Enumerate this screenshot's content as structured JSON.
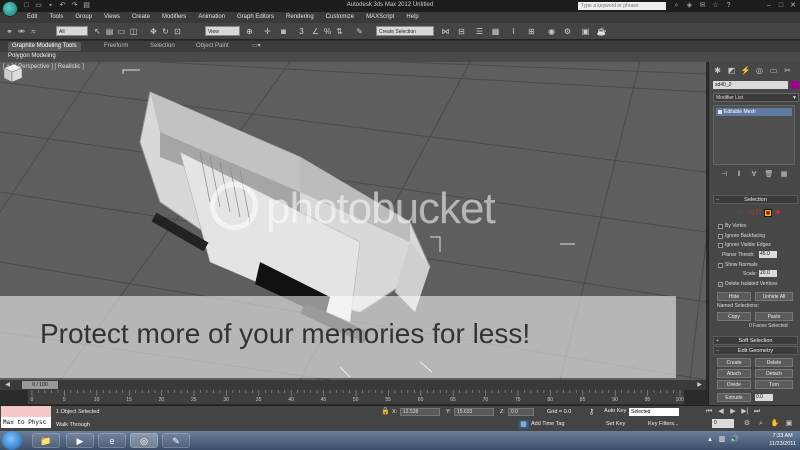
{
  "titlebar": {
    "title": "Autodesk 3ds Max 2012     Untitled",
    "help_search_placeholder": "Type a keyword or phrase",
    "quick_access": [
      "new-icon",
      "open-icon",
      "save-icon",
      "undo-icon",
      "redo-icon",
      "project-folder-icon"
    ],
    "icons": [
      "search-icon",
      "subscription-icon",
      "comm-center-icon",
      "favorites-icon",
      "help-icon"
    ]
  },
  "menu": {
    "items": [
      "Edit",
      "Tools",
      "Group",
      "Views",
      "Create",
      "Modifiers",
      "Animation",
      "Graph Editors",
      "Rendering",
      "Customize",
      "MAXScript",
      "Help"
    ]
  },
  "toolbar": {
    "selection_filter": "All",
    "reference_coord": "View",
    "named_selection": "Create Selection"
  },
  "ribbon": {
    "tabs": [
      "Graphite Modeling Tools",
      "Freeform",
      "Selection",
      "Object Paint"
    ],
    "panel_label": "Polygon Modeling"
  },
  "viewport": {
    "label": "[ + ] [ Perspective ] [ Realistic ]"
  },
  "command_panel": {
    "object_name": "sd40_2",
    "object_color": "#a0008c",
    "modifier_list_label": "Modifier List",
    "stack_items": [
      "Editable Mesh"
    ],
    "selection_rollout": {
      "title": "Selection",
      "checkboxes": [
        {
          "label": "By Vertex",
          "checked": false
        },
        {
          "label": "Ignore Backfacing",
          "checked": false
        },
        {
          "label": "Ignore Visible Edges",
          "checked": false
        }
      ],
      "planar_thresh_label": "Planar Thresh:",
      "planar_thresh_value": "45.0",
      "show_normals_label": "Show Normals",
      "scale_label": "Scale:",
      "scale_value": "20.0",
      "delete_isolated_label": "Delete Isolated Vertices",
      "hide_label": "Hide",
      "unhide_all_label": "Unhide All",
      "named_selections_label": "Named Selections:",
      "copy_label": "Copy",
      "paste_label": "Paste",
      "faces_selected": "0 Faces Selected"
    },
    "soft_selection_title": "Soft Selection",
    "edit_geometry": {
      "title": "Edit Geometry",
      "create_label": "Create",
      "delete_label": "Delete",
      "attach_label": "Attach",
      "detach_label": "Detach",
      "divide_label": "Divide",
      "turn_label": "Turn",
      "extrude_label": "Extrude",
      "extrude_value": "0.0"
    }
  },
  "timeline": {
    "slider_label": "0 / 100",
    "frame_labels": [
      "0",
      "5",
      "10",
      "15",
      "20",
      "25",
      "30",
      "35",
      "40",
      "45",
      "50",
      "55",
      "60",
      "65",
      "70",
      "75",
      "80",
      "85",
      "90",
      "95",
      "100"
    ]
  },
  "statusbar": {
    "maxscript_text": "Max to Physc",
    "status_message": "1 Object Selected",
    "prompt_message": "Walk Through",
    "x_label": "X:",
    "x_value": "13.538",
    "y_label": "Y:",
    "y_value": "15.633",
    "z_label": "Z:",
    "z_value": "0.0",
    "grid_label": "Grid = 0.0",
    "add_time_tag": "Add Time Tag",
    "auto_key": "Auto Key",
    "auto_key_mode": "Selected",
    "set_key": "Set Key",
    "key_filters": "Key Filters...",
    "current_frame": "0"
  },
  "taskbar": {
    "time": "7:33 AM",
    "date": "11/23/2011",
    "apps": [
      "explorer-icon",
      "media-player-icon",
      "ie-icon",
      "3dsmax-icon",
      "paint-icon"
    ]
  },
  "watermark": {
    "center_text": "photobucket",
    "band_text": "Protect more of your memories for less!"
  }
}
